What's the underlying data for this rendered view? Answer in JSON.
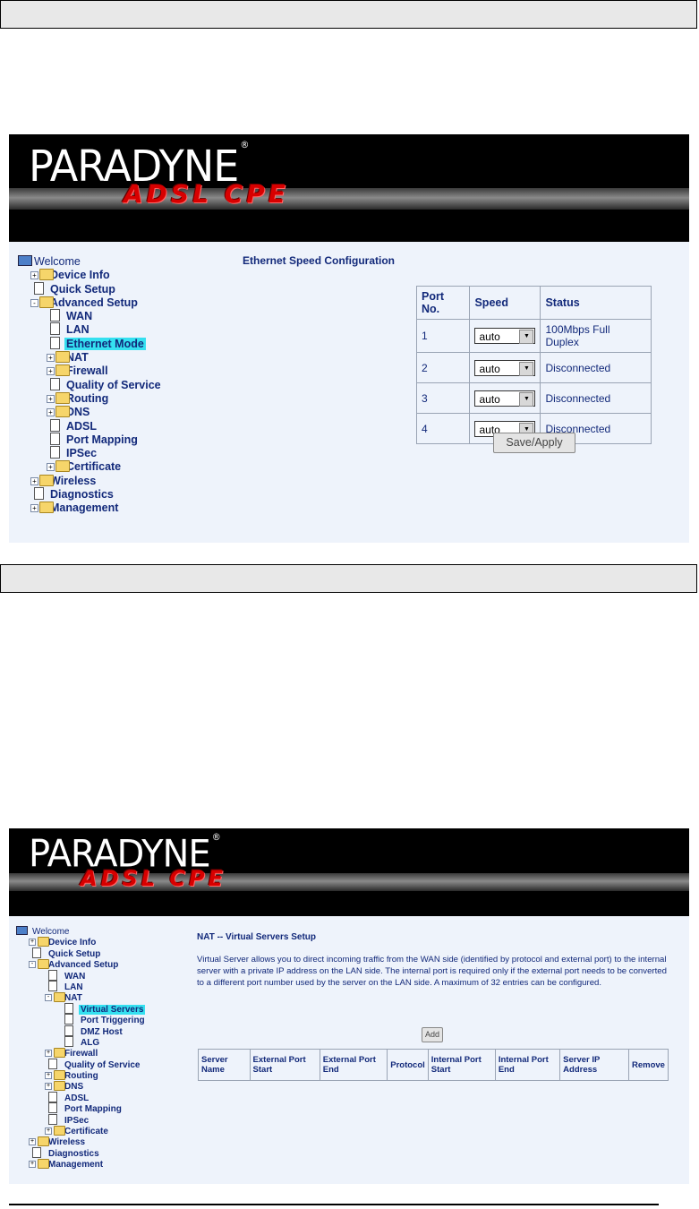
{
  "screen1": {
    "brand": "PARADYNE",
    "brand_reg": "®",
    "product": "ADSL CPE",
    "page_title": "Ethernet Speed Configuration",
    "tree": [
      {
        "label": "Welcome",
        "icon": "computer-icon",
        "expander": ""
      },
      {
        "label": "Device Info",
        "icon": "folder-icon",
        "expander": "+"
      },
      {
        "label": "Quick Setup",
        "icon": "page-icon",
        "expander": ""
      },
      {
        "label": "Advanced Setup",
        "icon": "folder-open-icon",
        "expander": "-"
      },
      {
        "label": "WAN",
        "icon": "page-icon",
        "expander": ""
      },
      {
        "label": "LAN",
        "icon": "page-icon",
        "expander": ""
      },
      {
        "label": "Ethernet Mode",
        "icon": "page-icon",
        "expander": "",
        "selected": true
      },
      {
        "label": "NAT",
        "icon": "folder-icon",
        "expander": "+"
      },
      {
        "label": "Firewall",
        "icon": "folder-icon",
        "expander": "+"
      },
      {
        "label": "Quality of Service",
        "icon": "page-icon",
        "expander": ""
      },
      {
        "label": "Routing",
        "icon": "folder-icon",
        "expander": "+"
      },
      {
        "label": "DNS",
        "icon": "folder-icon",
        "expander": "+"
      },
      {
        "label": "ADSL",
        "icon": "page-icon",
        "expander": ""
      },
      {
        "label": "Port Mapping",
        "icon": "page-icon",
        "expander": ""
      },
      {
        "label": "IPSec",
        "icon": "page-icon",
        "expander": ""
      },
      {
        "label": "Certificate",
        "icon": "folder-icon",
        "expander": "+"
      },
      {
        "label": "Wireless",
        "icon": "folder-icon",
        "expander": "+"
      },
      {
        "label": "Diagnostics",
        "icon": "page-icon",
        "expander": ""
      },
      {
        "label": "Management",
        "icon": "folder-icon",
        "expander": "+"
      }
    ],
    "table": {
      "headers": [
        "Port No.",
        "Speed",
        "Status"
      ],
      "rows": [
        {
          "port": "1",
          "speed": "auto",
          "status": "100Mbps Full Duplex"
        },
        {
          "port": "2",
          "speed": "auto",
          "status": "Disconnected"
        },
        {
          "port": "3",
          "speed": "auto",
          "status": "Disconnected"
        },
        {
          "port": "4",
          "speed": "auto",
          "status": "Disconnected"
        }
      ]
    },
    "save_label": "Save/Apply"
  },
  "screen2": {
    "brand": "PARADYNE",
    "brand_reg": "®",
    "product": "ADSL CPE",
    "page_title": "NAT -- Virtual Servers Setup",
    "description": "Virtual Server allows you to direct incoming traffic from the WAN side (identified by protocol and external port) to the internal server with a private IP address on the LAN side. The internal port is required only if the external port needs to be converted to a different port number used by the server on the LAN side. A maximum of 32 entries can be configured.",
    "add_label": "Add",
    "tree": [
      {
        "label": "Welcome",
        "icon": "computer-icon",
        "expander": ""
      },
      {
        "label": "Device Info",
        "icon": "folder-icon",
        "expander": "+"
      },
      {
        "label": "Quick Setup",
        "icon": "page-icon",
        "expander": ""
      },
      {
        "label": "Advanced Setup",
        "icon": "folder-open-icon",
        "expander": "-"
      },
      {
        "label": "WAN",
        "icon": "page-icon",
        "expander": ""
      },
      {
        "label": "LAN",
        "icon": "page-icon",
        "expander": ""
      },
      {
        "label": "NAT",
        "icon": "folder-open-icon",
        "expander": "-"
      },
      {
        "label": "Virtual Servers",
        "icon": "page-icon",
        "expander": "",
        "selected": true
      },
      {
        "label": "Port Triggering",
        "icon": "page-icon",
        "expander": ""
      },
      {
        "label": "DMZ Host",
        "icon": "page-icon",
        "expander": ""
      },
      {
        "label": "ALG",
        "icon": "page-icon",
        "expander": ""
      },
      {
        "label": "Firewall",
        "icon": "folder-icon",
        "expander": "+"
      },
      {
        "label": "Quality of Service",
        "icon": "page-icon",
        "expander": ""
      },
      {
        "label": "Routing",
        "icon": "folder-icon",
        "expander": "+"
      },
      {
        "label": "DNS",
        "icon": "folder-icon",
        "expander": "+"
      },
      {
        "label": "ADSL",
        "icon": "page-icon",
        "expander": ""
      },
      {
        "label": "Port Mapping",
        "icon": "page-icon",
        "expander": ""
      },
      {
        "label": "IPSec",
        "icon": "page-icon",
        "expander": ""
      },
      {
        "label": "Certificate",
        "icon": "folder-icon",
        "expander": "+"
      },
      {
        "label": "Wireless",
        "icon": "folder-icon",
        "expander": "+"
      },
      {
        "label": "Diagnostics",
        "icon": "page-icon",
        "expander": ""
      },
      {
        "label": "Management",
        "icon": "folder-icon",
        "expander": "+"
      }
    ],
    "table_headers": [
      "Server Name",
      "External Port Start",
      "External Port End",
      "Protocol",
      "Internal Port Start",
      "Internal Port End",
      "Server IP Address",
      "Remove"
    ]
  },
  "colors": {
    "link": "#12297a",
    "highlight": "#35e0f0",
    "panel": "#eef3fb",
    "brand_red": "#d80000"
  }
}
